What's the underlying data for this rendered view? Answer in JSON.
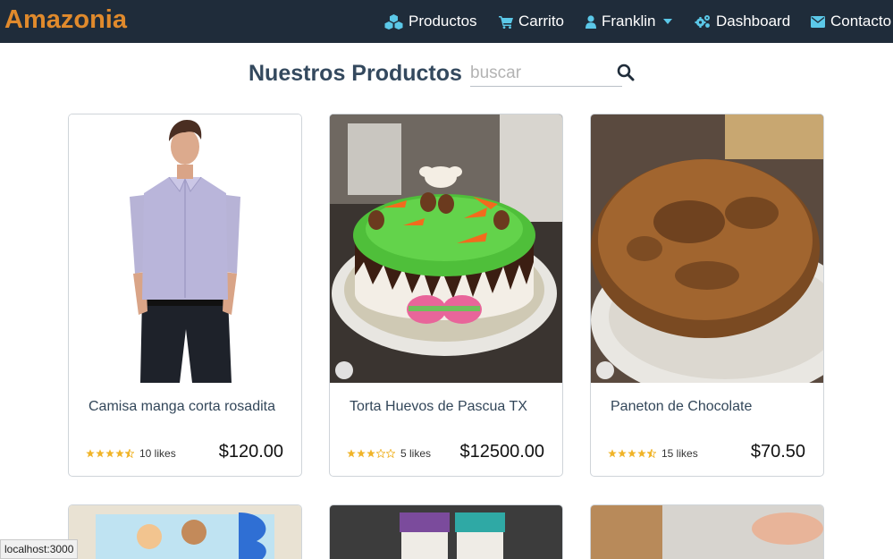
{
  "brand": "Amazonia",
  "nav": {
    "productos": "Productos",
    "carrito": "Carrito",
    "user": "Franklin",
    "dashboard": "Dashboard",
    "contacto": "Contacto"
  },
  "heading": "Nuestros Productos",
  "search": {
    "placeholder": "buscar"
  },
  "products": [
    {
      "name": "Camisa manga corta rosadita",
      "rating": 4.5,
      "likes": "10 likes",
      "price": "$120.00"
    },
    {
      "name": "Torta Huevos de Pascua TX",
      "rating": 3,
      "likes": "5 likes",
      "price": "$12500.00"
    },
    {
      "name": "Paneton de Chocolate",
      "rating": 4.5,
      "likes": "15 likes",
      "price": "$70.50"
    }
  ],
  "status_url": "localhost:3000",
  "colors": {
    "navbar": "#1f2c3a",
    "brand": "#e08a2c",
    "icon": "#5bc8e8",
    "star": "#f0b429"
  }
}
